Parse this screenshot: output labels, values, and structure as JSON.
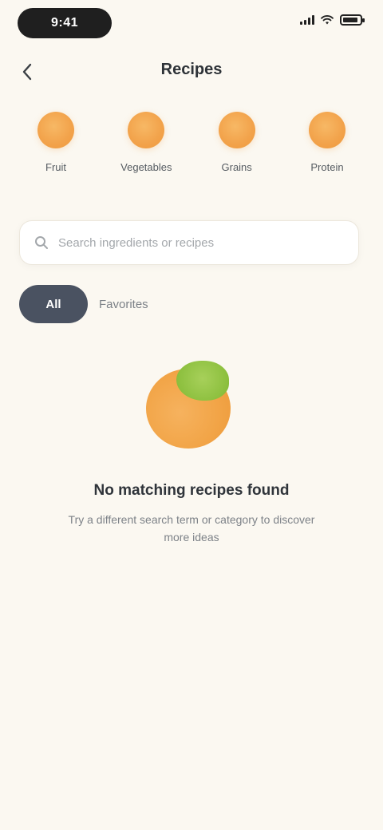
{
  "status_bar": {
    "time": "9:41"
  },
  "header": {
    "back_icon": "chevron-left-icon",
    "title": "Recipes"
  },
  "categories": [
    {
      "label": "Fruit",
      "icon": "orange-fruit-icon"
    },
    {
      "label": "Vegetables",
      "icon": "orange-fruit-icon"
    },
    {
      "label": "Grains",
      "icon": "orange-fruit-icon"
    },
    {
      "label": "Protein",
      "icon": "orange-fruit-icon"
    }
  ],
  "search": {
    "placeholder": "Search ingredients or recipes",
    "value": ""
  },
  "filters": {
    "active_label": "All",
    "secondary_label": "Favorites"
  },
  "empty_state": {
    "illustration": "orange-with-leaf",
    "title": "No matching recipes found",
    "subtitle": "Try a different search term or category to discover more ideas"
  },
  "colors": {
    "background": "#FBF8F1",
    "accent_orange": "#F2A24A",
    "accent_green": "#8DC03F",
    "chip_dark": "#4A5261"
  }
}
